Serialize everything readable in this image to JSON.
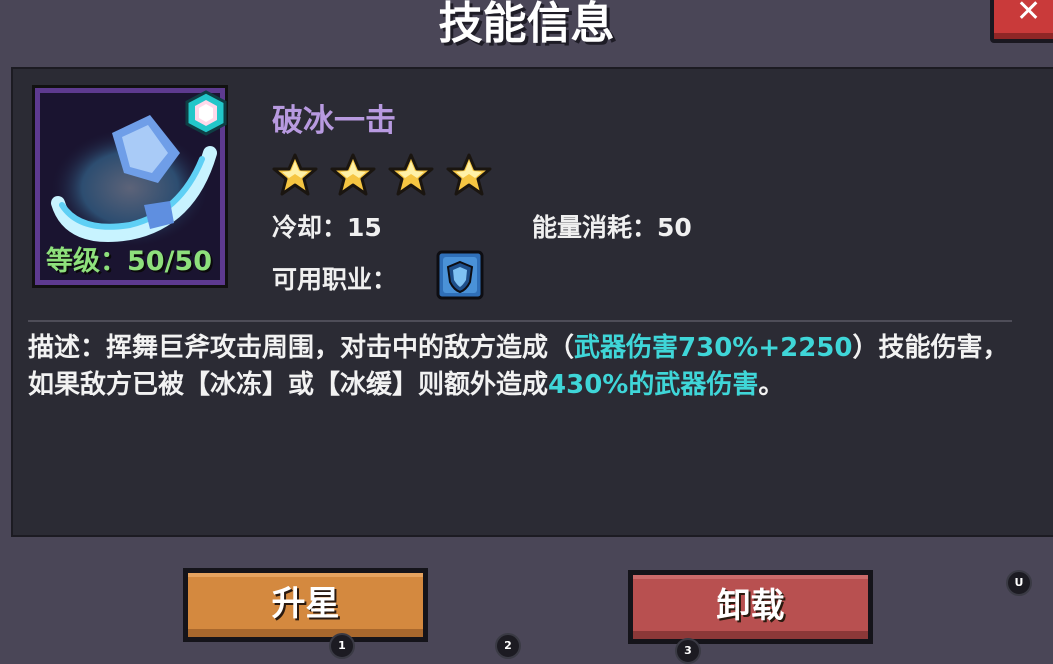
{
  "header": {
    "title": "技能信息"
  },
  "skill": {
    "name": "破冰一击",
    "level_label": "等级：",
    "level_value": "50/50",
    "stars": 4,
    "cooldown_label": "冷却：",
    "cooldown_value": "15",
    "energy_label": "能量消耗：",
    "energy_value": "50",
    "class_label": "可用职业：",
    "icon": "ice-axe-swing-icon",
    "gem_icon": "cyan-gem-icon",
    "class_icon": "shield-class-icon"
  },
  "description": {
    "part1": "描述：挥舞巨斧攻击周围，对击中的敌方造成（",
    "highlight1": "武器伤害730%+2250",
    "part2": "）技能伤害，如果敌方已被【冰冻】或【冰缓】则额外造成",
    "highlight2": "430%的武器伤害",
    "part3": "。"
  },
  "buttons": {
    "upgrade_label": "升星",
    "unload_label": "卸载"
  },
  "hints": [
    "1",
    "2",
    "3",
    "U"
  ],
  "colors": {
    "background": "#4a4657",
    "panel": "#2b2b34",
    "skill_name": "#b89ae0",
    "level": "#8ee07c",
    "highlight": "#3fd6d8",
    "upgrade_button": "#d4893f",
    "unload_button": "#b85050",
    "close_button": "#c93a3a"
  }
}
